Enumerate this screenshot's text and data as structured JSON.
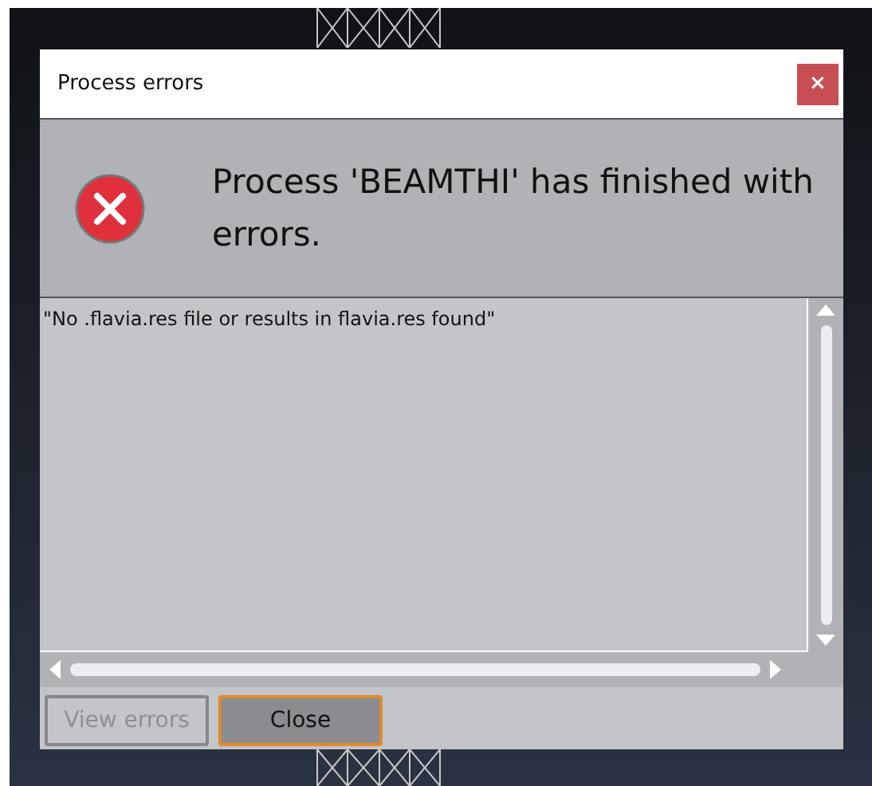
{
  "window": {
    "title": "Process errors",
    "close": "×"
  },
  "message": "Process 'BEAMTHI' has finished with errors.",
  "log": [
    "\"No .flavia.res file or results in flavia.res found\""
  ],
  "buttons": [
    {
      "label": "View errors",
      "disabled": true,
      "focused": false
    },
    {
      "label": "Close",
      "disabled": false,
      "focused": true
    }
  ]
}
